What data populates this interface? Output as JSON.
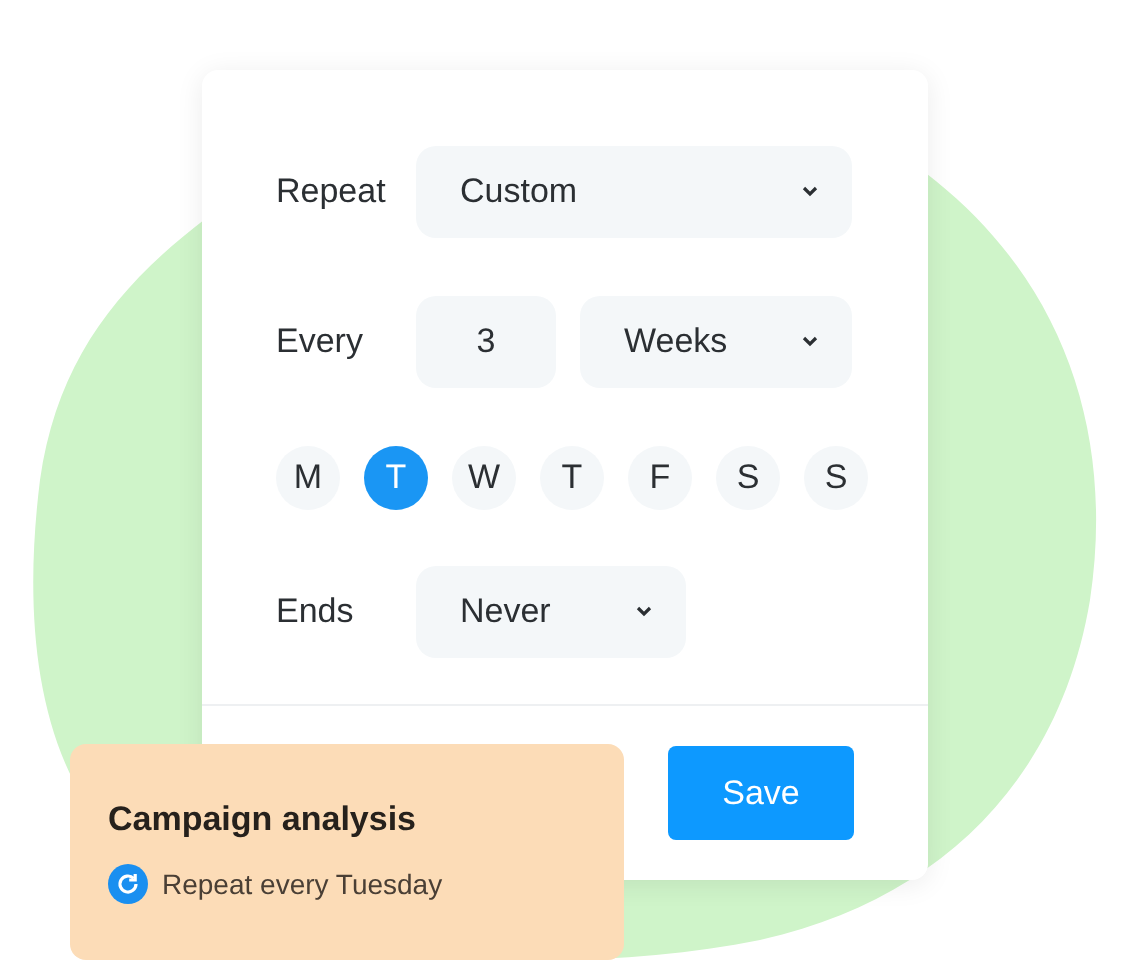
{
  "form": {
    "repeat": {
      "label": "Repeat",
      "value": "Custom"
    },
    "every": {
      "label": "Every",
      "count": "3",
      "unit": "Weeks"
    },
    "days": [
      {
        "label": "M",
        "selected": false
      },
      {
        "label": "T",
        "selected": true
      },
      {
        "label": "W",
        "selected": false
      },
      {
        "label": "T",
        "selected": false
      },
      {
        "label": "F",
        "selected": false
      },
      {
        "label": "S",
        "selected": false
      },
      {
        "label": "S",
        "selected": false
      }
    ],
    "ends": {
      "label": "Ends",
      "value": "Never"
    },
    "save_button": "Save"
  },
  "task_card": {
    "title": "Campaign analysis",
    "repeat_text": "Repeat every Tuesday"
  }
}
